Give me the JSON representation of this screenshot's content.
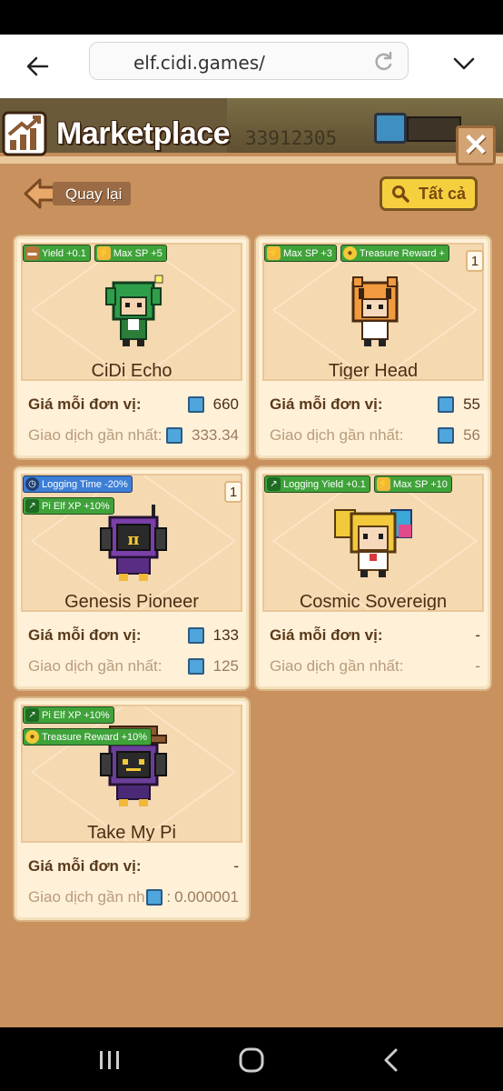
{
  "browser": {
    "url": "elf.cidi.games/"
  },
  "header": {
    "title": "Marketplace",
    "hud_number": "33912305",
    "close_label": "✕"
  },
  "toolbar": {
    "back_label": "Quay lại",
    "filter_label": "Tất cả"
  },
  "labels": {
    "price": "Giá mỗi đơn vị:",
    "last_trade": "Giao dịch gần nhất:",
    "last_trade_truncated": "Giao dịch gần nh"
  },
  "cards": [
    {
      "name": "CiDi Echo",
      "badges": [
        "Yield +0.1",
        "Max SP +5"
      ],
      "count": "",
      "price": "660",
      "last_trade": "333.34"
    },
    {
      "name": "Tiger Head",
      "badges": [
        "Max SP +3",
        "Treasure Reward +"
      ],
      "count": "1",
      "price": "55",
      "last_trade": "56"
    },
    {
      "name": "Genesis Pioneer",
      "badges": [
        "Logging Time -20%",
        "Pi Elf XP +10%"
      ],
      "count": "1",
      "price": "133",
      "last_trade": "125"
    },
    {
      "name": "Cosmic Sovereign",
      "badges": [
        "Logging Yield +0.1",
        "Max SP +10"
      ],
      "count": "",
      "price": "-",
      "last_trade": "-"
    },
    {
      "name": "Take My Pi",
      "badges": [
        "Pi Elf XP +10%",
        "Treasure Reward +10%"
      ],
      "count": "",
      "price": "-",
      "last_trade": "0.000001"
    }
  ],
  "colors": {
    "panel": "#c8915e",
    "card": "#fff0d8",
    "badge_green": "#3fa33a",
    "badge_blue": "#3d7fd6",
    "filter_button": "#f6cf3f"
  }
}
